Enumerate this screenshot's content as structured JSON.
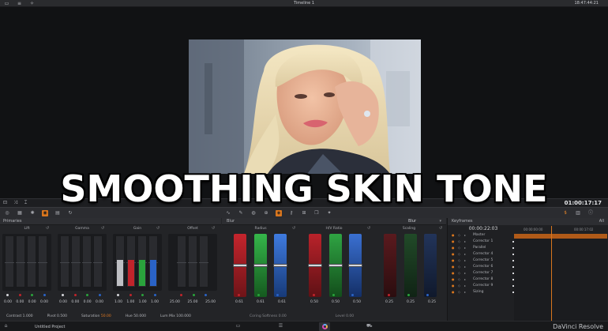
{
  "topbar": {
    "title": "Timeline 1",
    "time": "18:47:44:21",
    "icons": [
      "viewer-layout-icon",
      "clip-strip-icon",
      "tool-icon"
    ]
  },
  "overlay_title": "SMOOTHING SKIN TONE",
  "timeline": {
    "timecode": "01:00:17:17"
  },
  "primaries": {
    "header": "Primaries",
    "wheels": [
      {
        "label": "Lift",
        "values": [
          "0.00",
          "0.00",
          "0.00",
          "0.00"
        ]
      },
      {
        "label": "Gamma",
        "values": [
          "0.00",
          "0.00",
          "0.00",
          "0.00"
        ]
      },
      {
        "label": "Gain",
        "values": [
          "1.00",
          "1.00",
          "1.00",
          "1.00"
        ]
      },
      {
        "label": "Offset",
        "values": [
          "25.00",
          "25.00",
          "25.00"
        ]
      }
    ],
    "bottom": {
      "contrast_label": "Contrast",
      "contrast_value": "1.000",
      "pivot_label": "Pivot",
      "pivot_value": "0.500",
      "saturation_label": "Saturation",
      "saturation_value": "50.00",
      "hue_label": "Hue",
      "hue_value": "50.000",
      "lum_mix_label": "Lum Mix",
      "lum_mix_value": "100.000"
    }
  },
  "blur": {
    "header": "Blur",
    "mode": "Blur",
    "groups": [
      {
        "label": "Radius",
        "values": [
          "0.61",
          "0.61",
          "0.61"
        ],
        "levels": [
          0.5,
          0.5,
          0.5
        ]
      },
      {
        "label": "H/V Ratio",
        "values": [
          "0.50",
          "0.50",
          "0.50"
        ],
        "levels": [
          0.5,
          0.5,
          0.5
        ]
      },
      {
        "label": "Scaling",
        "values": [
          "0.25",
          "0.25",
          "0.25"
        ],
        "levels": [
          0.5,
          0.5,
          0.5
        ]
      }
    ],
    "bottom_left": "Coring Softness 0.00",
    "bottom_mid": "Level 0.00"
  },
  "keyframes": {
    "header": "Keyframes",
    "filter": "All",
    "current_time": "00:00:22:03",
    "time_a": "00:00:00:00",
    "time_b": "00:00:17:02",
    "rows": [
      "Master",
      "Corrector 1",
      "Parallel",
      "Corrector 4",
      "Corrector 5",
      "Corrector 6",
      "Corrector 7",
      "Corrector 8",
      "Corrector 9",
      "Sizing"
    ]
  },
  "status": {
    "project": "Untitled Project",
    "brand": "DaVinci Resolve"
  },
  "colors": {
    "accent": "#d9761e",
    "red": "#c0242b",
    "green": "#2aa33c",
    "blue": "#2a63c6"
  }
}
